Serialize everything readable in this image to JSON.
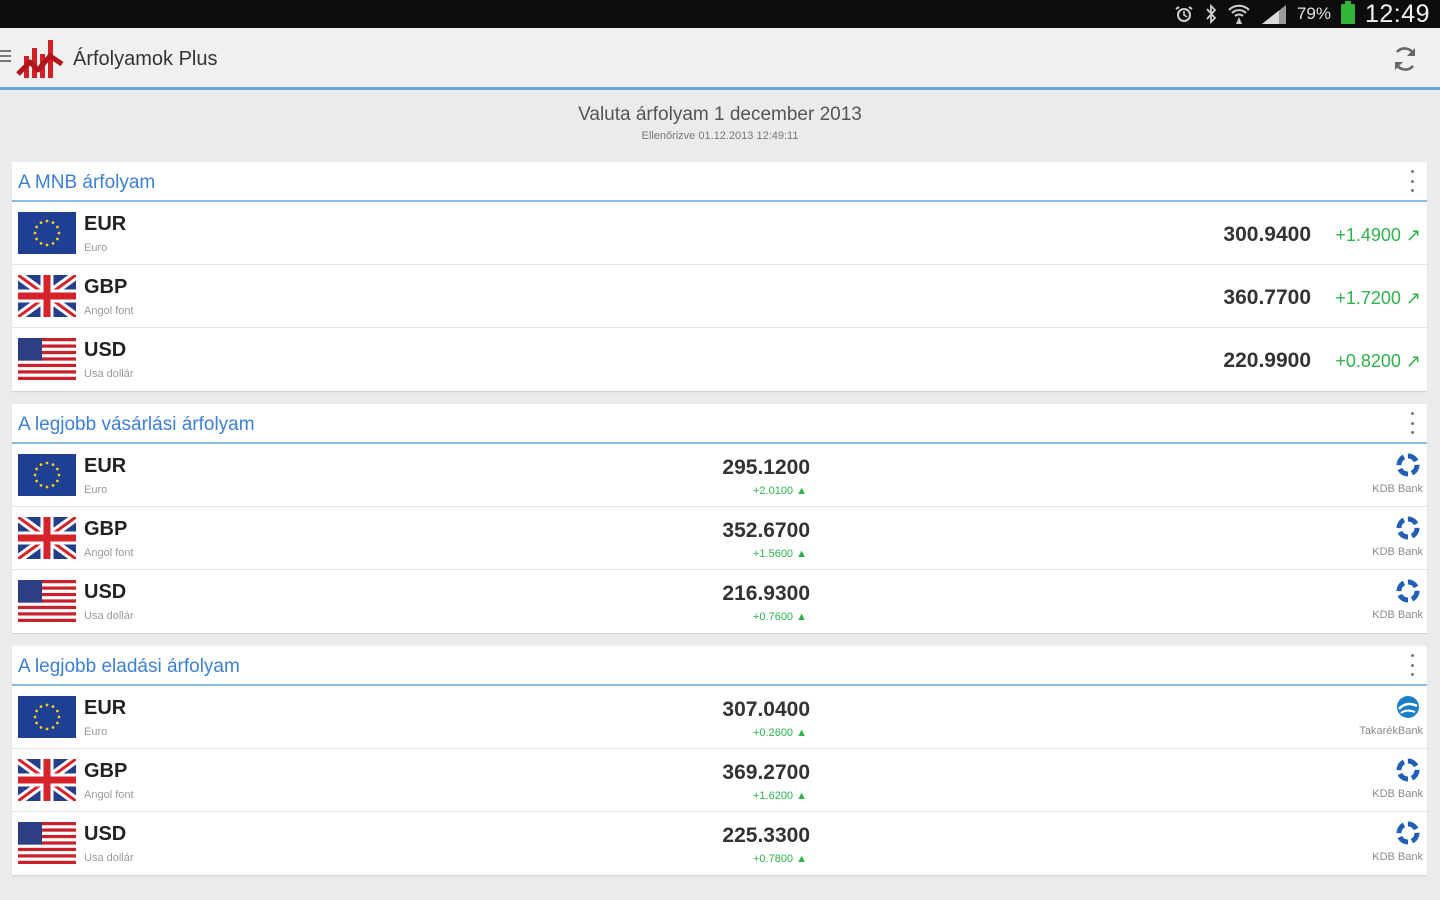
{
  "status_bar": {
    "icons": [
      "alarm-icon",
      "bluetooth-icon",
      "wifi-icon",
      "signal-icon"
    ],
    "battery_percent": "79%",
    "battery_color": "#34b53a",
    "time": "12:49"
  },
  "action_bar": {
    "title": "Árfolyamok Plus",
    "accent_color": "#5fa8d7",
    "menu_icon": "hamburger-icon",
    "logo_icon": "app-logo-icon",
    "refresh_icon": "refresh-icon"
  },
  "header": {
    "title": "Valuta árfolyam 1 december 2013",
    "subtitle": "Ellenőrizve 01.12.2013 12:49:11"
  },
  "colors": {
    "section_title": "#3b7fd6",
    "positive_change": "#2cb34a"
  },
  "mnb": {
    "title": "A MNB árfolyam",
    "rows": [
      {
        "code": "EUR",
        "name": "Euro",
        "flag": "eu-flag-icon",
        "rate": "300.9400",
        "change": "+1.4900 ↗"
      },
      {
        "code": "GBP",
        "name": "Angol font",
        "flag": "uk-flag-icon",
        "rate": "360.7700",
        "change": "+1.7200 ↗"
      },
      {
        "code": "USD",
        "name": "Usa dollár",
        "flag": "us-flag-icon",
        "rate": "220.9900",
        "change": "+0.8200 ↗"
      }
    ]
  },
  "buy": {
    "title": "A legjobb vásárlási árfolyam",
    "rows": [
      {
        "code": "EUR",
        "name": "Euro",
        "flag": "eu-flag-icon",
        "rate": "295.1200",
        "change": "+2.0100 ▲",
        "bank": "KDB Bank",
        "bank_icon": "kdb-bank-icon"
      },
      {
        "code": "GBP",
        "name": "Angol font",
        "flag": "uk-flag-icon",
        "rate": "352.6700",
        "change": "+1.5600 ▲",
        "bank": "KDB Bank",
        "bank_icon": "kdb-bank-icon"
      },
      {
        "code": "USD",
        "name": "Usa dollár",
        "flag": "us-flag-icon",
        "rate": "216.9300",
        "change": "+0.7600 ▲",
        "bank": "KDB Bank",
        "bank_icon": "kdb-bank-icon"
      }
    ]
  },
  "sell": {
    "title": "A legjobb eladási árfolyam",
    "rows": [
      {
        "code": "EUR",
        "name": "Euro",
        "flag": "eu-flag-icon",
        "rate": "307.0400",
        "change": "+0.2600 ▲",
        "bank": "TakarékBank",
        "bank_icon": "takarekbank-icon"
      },
      {
        "code": "GBP",
        "name": "Angol font",
        "flag": "uk-flag-icon",
        "rate": "369.2700",
        "change": "+1.6200 ▲",
        "bank": "KDB Bank",
        "bank_icon": "kdb-bank-icon"
      },
      {
        "code": "USD",
        "name": "Usa dollár",
        "flag": "us-flag-icon",
        "rate": "225.3300",
        "change": "+0.7800 ▲",
        "bank": "KDB Bank",
        "bank_icon": "kdb-bank-icon"
      }
    ]
  }
}
